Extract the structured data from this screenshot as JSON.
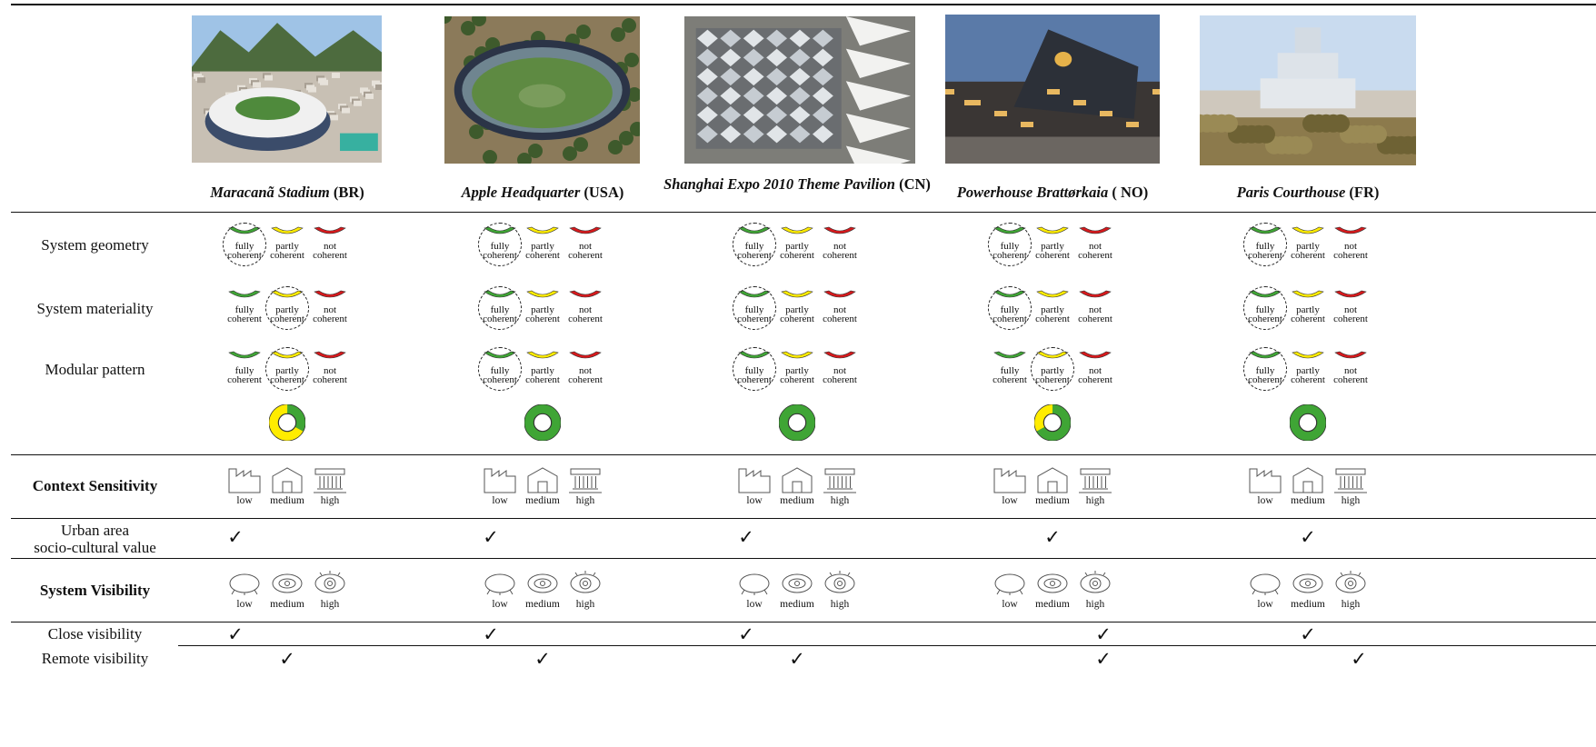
{
  "buildings": [
    {
      "name": "Maracanã Stadium",
      "country": "(BR)",
      "photo": "stadium-aerial",
      "coherence": {
        "system_geometry": "fully",
        "system_materiality": "partly",
        "modular_pattern": "partly"
      },
      "donut": {
        "green": 0.33,
        "yellow": 0.67
      },
      "urban_socio_cultural": "✓",
      "close_visibility": "✓",
      "remote_visibility": "✓"
    },
    {
      "name": "Apple Headquarter",
      "country": "(USA)",
      "photo": "ring-campus-aerial",
      "coherence": {
        "system_geometry": "fully",
        "system_materiality": "fully",
        "modular_pattern": "fully"
      },
      "donut": {
        "green": 1.0,
        "yellow": 0.0
      },
      "urban_socio_cultural": "✓",
      "close_visibility": "✓",
      "remote_visibility": "✓"
    },
    {
      "name": "Shanghai Expo 2010 Theme Pavilion",
      "country": "(CN)",
      "photo": "pavilion-roof-aerial",
      "coherence": {
        "system_geometry": "fully",
        "system_materiality": "fully",
        "modular_pattern": "fully"
      },
      "donut": {
        "green": 1.0,
        "yellow": 0.0
      },
      "urban_socio_cultural": "✓",
      "close_visibility": "✓",
      "remote_visibility": "✓"
    },
    {
      "name": "Powerhouse Brattørkaia",
      "country": "( NO)",
      "photo": "powerhouse-dusk",
      "coherence": {
        "system_geometry": "fully",
        "system_materiality": "fully",
        "modular_pattern": "partly"
      },
      "donut": {
        "green": 0.67,
        "yellow": 0.33
      },
      "urban_socio_cultural": "✓",
      "close_visibility": "✓",
      "remote_visibility": "✓"
    },
    {
      "name": "Paris Courthouse",
      "country": "(FR)",
      "photo": "courthouse-skyline",
      "coherence": {
        "system_geometry": "fully",
        "system_materiality": "fully",
        "modular_pattern": "fully"
      },
      "donut": {
        "green": 1.0,
        "yellow": 0.0
      },
      "urban_socio_cultural": "✓",
      "close_visibility": "✓",
      "remote_visibility": "✓"
    }
  ],
  "coherence_labels": {
    "fully": [
      "fully",
      "coherent"
    ],
    "partly": [
      "partly",
      "coherent"
    ],
    "not": [
      "not",
      "coherent"
    ]
  },
  "coherence_colors": {
    "fully": "#3fa535",
    "partly": "#ffec00",
    "not": "#d7191c"
  },
  "rows": {
    "system_geometry": "System geometry",
    "system_materiality": "System materiality",
    "modular_pattern": "Modular pattern",
    "context_sensitivity": "Context Sensitivity",
    "urban_area": [
      "Urban area",
      "socio-cultural value"
    ],
    "system_visibility": "System Visibility",
    "close_visibility": "Close visibility",
    "remote_visibility": "Remote visibility"
  },
  "level_labels": [
    "low",
    "medium",
    "high"
  ],
  "icons": {
    "context": [
      "factory-icon",
      "house-icon",
      "temple-icon"
    ],
    "visibility": [
      "closed-eye-icon",
      "half-eye-icon",
      "open-eye-icon"
    ]
  }
}
